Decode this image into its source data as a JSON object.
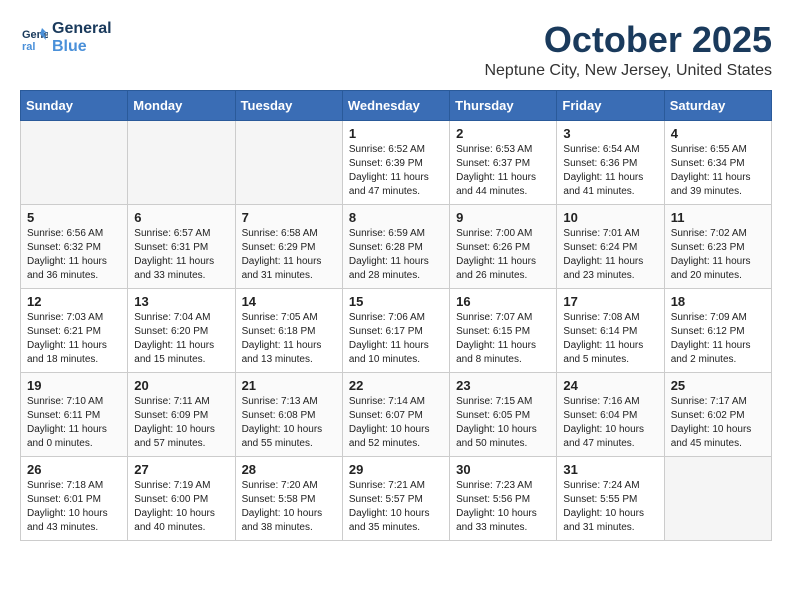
{
  "header": {
    "logo_line1": "General",
    "logo_line2": "Blue",
    "month": "October 2025",
    "location": "Neptune City, New Jersey, United States"
  },
  "weekdays": [
    "Sunday",
    "Monday",
    "Tuesday",
    "Wednesday",
    "Thursday",
    "Friday",
    "Saturday"
  ],
  "weeks": [
    [
      {
        "day": "",
        "info": ""
      },
      {
        "day": "",
        "info": ""
      },
      {
        "day": "",
        "info": ""
      },
      {
        "day": "1",
        "info": "Sunrise: 6:52 AM\nSunset: 6:39 PM\nDaylight: 11 hours\nand 47 minutes."
      },
      {
        "day": "2",
        "info": "Sunrise: 6:53 AM\nSunset: 6:37 PM\nDaylight: 11 hours\nand 44 minutes."
      },
      {
        "day": "3",
        "info": "Sunrise: 6:54 AM\nSunset: 6:36 PM\nDaylight: 11 hours\nand 41 minutes."
      },
      {
        "day": "4",
        "info": "Sunrise: 6:55 AM\nSunset: 6:34 PM\nDaylight: 11 hours\nand 39 minutes."
      }
    ],
    [
      {
        "day": "5",
        "info": "Sunrise: 6:56 AM\nSunset: 6:32 PM\nDaylight: 11 hours\nand 36 minutes."
      },
      {
        "day": "6",
        "info": "Sunrise: 6:57 AM\nSunset: 6:31 PM\nDaylight: 11 hours\nand 33 minutes."
      },
      {
        "day": "7",
        "info": "Sunrise: 6:58 AM\nSunset: 6:29 PM\nDaylight: 11 hours\nand 31 minutes."
      },
      {
        "day": "8",
        "info": "Sunrise: 6:59 AM\nSunset: 6:28 PM\nDaylight: 11 hours\nand 28 minutes."
      },
      {
        "day": "9",
        "info": "Sunrise: 7:00 AM\nSunset: 6:26 PM\nDaylight: 11 hours\nand 26 minutes."
      },
      {
        "day": "10",
        "info": "Sunrise: 7:01 AM\nSunset: 6:24 PM\nDaylight: 11 hours\nand 23 minutes."
      },
      {
        "day": "11",
        "info": "Sunrise: 7:02 AM\nSunset: 6:23 PM\nDaylight: 11 hours\nand 20 minutes."
      }
    ],
    [
      {
        "day": "12",
        "info": "Sunrise: 7:03 AM\nSunset: 6:21 PM\nDaylight: 11 hours\nand 18 minutes."
      },
      {
        "day": "13",
        "info": "Sunrise: 7:04 AM\nSunset: 6:20 PM\nDaylight: 11 hours\nand 15 minutes."
      },
      {
        "day": "14",
        "info": "Sunrise: 7:05 AM\nSunset: 6:18 PM\nDaylight: 11 hours\nand 13 minutes."
      },
      {
        "day": "15",
        "info": "Sunrise: 7:06 AM\nSunset: 6:17 PM\nDaylight: 11 hours\nand 10 minutes."
      },
      {
        "day": "16",
        "info": "Sunrise: 7:07 AM\nSunset: 6:15 PM\nDaylight: 11 hours\nand 8 minutes."
      },
      {
        "day": "17",
        "info": "Sunrise: 7:08 AM\nSunset: 6:14 PM\nDaylight: 11 hours\nand 5 minutes."
      },
      {
        "day": "18",
        "info": "Sunrise: 7:09 AM\nSunset: 6:12 PM\nDaylight: 11 hours\nand 2 minutes."
      }
    ],
    [
      {
        "day": "19",
        "info": "Sunrise: 7:10 AM\nSunset: 6:11 PM\nDaylight: 11 hours\nand 0 minutes."
      },
      {
        "day": "20",
        "info": "Sunrise: 7:11 AM\nSunset: 6:09 PM\nDaylight: 10 hours\nand 57 minutes."
      },
      {
        "day": "21",
        "info": "Sunrise: 7:13 AM\nSunset: 6:08 PM\nDaylight: 10 hours\nand 55 minutes."
      },
      {
        "day": "22",
        "info": "Sunrise: 7:14 AM\nSunset: 6:07 PM\nDaylight: 10 hours\nand 52 minutes."
      },
      {
        "day": "23",
        "info": "Sunrise: 7:15 AM\nSunset: 6:05 PM\nDaylight: 10 hours\nand 50 minutes."
      },
      {
        "day": "24",
        "info": "Sunrise: 7:16 AM\nSunset: 6:04 PM\nDaylight: 10 hours\nand 47 minutes."
      },
      {
        "day": "25",
        "info": "Sunrise: 7:17 AM\nSunset: 6:02 PM\nDaylight: 10 hours\nand 45 minutes."
      }
    ],
    [
      {
        "day": "26",
        "info": "Sunrise: 7:18 AM\nSunset: 6:01 PM\nDaylight: 10 hours\nand 43 minutes."
      },
      {
        "day": "27",
        "info": "Sunrise: 7:19 AM\nSunset: 6:00 PM\nDaylight: 10 hours\nand 40 minutes."
      },
      {
        "day": "28",
        "info": "Sunrise: 7:20 AM\nSunset: 5:58 PM\nDaylight: 10 hours\nand 38 minutes."
      },
      {
        "day": "29",
        "info": "Sunrise: 7:21 AM\nSunset: 5:57 PM\nDaylight: 10 hours\nand 35 minutes."
      },
      {
        "day": "30",
        "info": "Sunrise: 7:23 AM\nSunset: 5:56 PM\nDaylight: 10 hours\nand 33 minutes."
      },
      {
        "day": "31",
        "info": "Sunrise: 7:24 AM\nSunset: 5:55 PM\nDaylight: 10 hours\nand 31 minutes."
      },
      {
        "day": "",
        "info": ""
      }
    ]
  ]
}
